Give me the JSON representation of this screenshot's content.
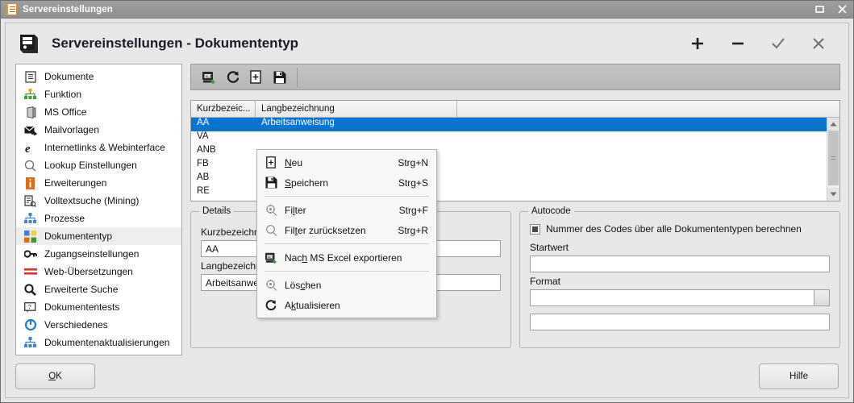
{
  "titlebar": {
    "title": "Servereinstellungen",
    "icon": "document-icon",
    "maximize": "maximize-icon",
    "close": "close-icon"
  },
  "header": {
    "title": "Servereinstellungen - Dokumententyp",
    "icon": "server-icon",
    "actions": [
      {
        "name": "add-button",
        "glyph": "+"
      },
      {
        "name": "remove-button",
        "glyph": "−"
      },
      {
        "name": "confirm-button",
        "glyph": "✓"
      },
      {
        "name": "close-button",
        "glyph": "×"
      }
    ]
  },
  "sidebar": {
    "items": [
      {
        "label": "Dokumente",
        "icon": "document-list-icon"
      },
      {
        "label": "Funktion",
        "icon": "hierarchy-green-icon"
      },
      {
        "label": "MS Office",
        "icon": "ms-office-icon"
      },
      {
        "label": "Mailvorlagen",
        "icon": "mail-forward-icon"
      },
      {
        "label": "Internetlinks & Webinterface",
        "icon": "internet-explorer-icon"
      },
      {
        "label": "Lookup Einstellungen",
        "icon": "magnifier-outline-icon"
      },
      {
        "label": "Erweiterungen",
        "icon": "info-orange-icon"
      },
      {
        "label": "Volltextsuche (Mining)",
        "icon": "document-search-icon"
      },
      {
        "label": "Prozesse",
        "icon": "hierarchy-blue-icon"
      },
      {
        "label": "Dokumententyp",
        "icon": "color-blocks-icon",
        "selected": true
      },
      {
        "label": "Zugangseinstellungen",
        "icon": "key-icon"
      },
      {
        "label": "Web-Übersetzungen",
        "icon": "red-bars-icon"
      },
      {
        "label": "Erweiterte Suche",
        "icon": "magnifier-solid-icon"
      },
      {
        "label": "Dokumententests",
        "icon": "comment-icon"
      },
      {
        "label": "Verschiedenes",
        "icon": "circle-blue-icon"
      },
      {
        "label": "Dokumentenaktualisierungen",
        "icon": "hierarchy-blue-icon"
      }
    ]
  },
  "toolbar": {
    "buttons": [
      {
        "name": "export-excel-button",
        "icon": "excel-export-icon"
      },
      {
        "name": "refresh-button",
        "icon": "refresh-icon"
      },
      {
        "name": "new-button",
        "icon": "new-document-icon"
      },
      {
        "name": "save-button",
        "icon": "floppy-save-icon"
      }
    ]
  },
  "table": {
    "columns": [
      "Kurzbezeic...",
      "Langbezeichnung",
      ""
    ],
    "rows": [
      {
        "kurz": "AA",
        "lang": "Arbeitsanweisung",
        "selected": true
      },
      {
        "kurz": "VA",
        "lang": ""
      },
      {
        "kurz": "ANB",
        "lang": ""
      },
      {
        "kurz": "FB",
        "lang": ""
      },
      {
        "kurz": "AB",
        "lang": ""
      },
      {
        "kurz": "RE",
        "lang": ""
      }
    ],
    "scrollbar": {
      "up": "scroll-up-icon",
      "down": "scroll-down-icon"
    }
  },
  "context_menu": {
    "items": [
      {
        "type": "item",
        "label_pre": "",
        "label_u": "N",
        "label_post": "eu",
        "shortcut": "Strg+N",
        "icon": "new-document-icon",
        "name": "menu-item-neu"
      },
      {
        "type": "item",
        "label_pre": "",
        "label_u": "S",
        "label_post": "peichern",
        "shortcut": "Strg+S",
        "icon": "floppy-save-icon",
        "name": "menu-item-speichern"
      },
      {
        "type": "separator"
      },
      {
        "type": "item",
        "label_pre": "Fi",
        "label_u": "l",
        "label_post": "ter",
        "shortcut": "Strg+F",
        "icon": "filter-icon",
        "name": "menu-item-filter"
      },
      {
        "type": "item",
        "label_pre": "Fil",
        "label_u": "t",
        "label_post": "er zurücksetzen",
        "shortcut": "Strg+R",
        "icon": "filter-reset-icon",
        "name": "menu-item-filter-zuruecksetzen"
      },
      {
        "type": "separator"
      },
      {
        "type": "item",
        "label_pre": "Nac",
        "label_u": "h",
        "label_post": " MS Excel exportieren",
        "shortcut": "",
        "icon": "excel-export-icon",
        "name": "menu-item-excel-export"
      },
      {
        "type": "separator"
      },
      {
        "type": "item",
        "label_pre": "Lös",
        "label_u": "c",
        "label_post": "hen",
        "shortcut": "",
        "icon": "delete-icon",
        "name": "menu-item-loeschen"
      },
      {
        "type": "item",
        "label_pre": "A",
        "label_u": "k",
        "label_post": "tualisieren",
        "shortcut": "",
        "icon": "refresh-icon",
        "name": "menu-item-aktualisieren"
      }
    ]
  },
  "details": {
    "title": "Details",
    "kurz_label": "Kurzbezeichnung",
    "kurz_value": "AA",
    "lang_label": "Langbezeichnung",
    "lang_value": "Arbeitsanweisung"
  },
  "autocode": {
    "title": "Autocode",
    "checkbox_label": "Nummer des Codes über alle Dokumententypen berechnen",
    "checkbox_state": "indeterminate",
    "startwert_label": "Startwert",
    "startwert_value": "",
    "format_label": "Format",
    "format_value": "",
    "extra_value": ""
  },
  "footer": {
    "ok_u": "O",
    "ok_rest": "K",
    "help_label": "Hilfe"
  },
  "colors": {
    "selection": "#0a74d1",
    "accent_orange": "#e8922e",
    "window_bg": "#e8e8e8"
  }
}
